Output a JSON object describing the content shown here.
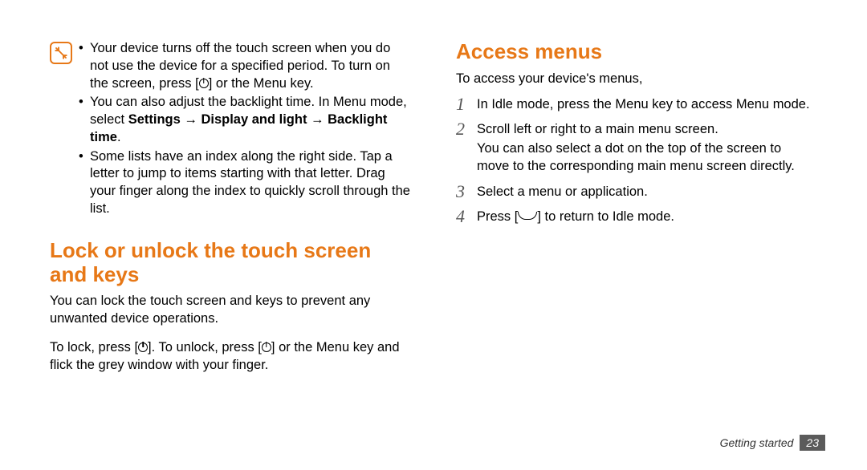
{
  "left": {
    "note_items": [
      {
        "pre": "Your device turns off the touch screen when you do not use the device for a specified period. To turn on the screen, press [",
        "icon": "power",
        "post": "] or the Menu key."
      },
      {
        "pre": "You can also adjust the backlight time. In Menu mode, select ",
        "bold": "Settings → Display and light → Backlight time",
        "post": "."
      },
      {
        "pre": "Some lists have an index along the right side. Tap a letter to jump to items starting with that letter. Drag your finger along the index to quickly scroll through the list."
      }
    ],
    "heading": "Lock or unlock the touch screen and keys",
    "p1": "You can lock the touch screen and keys to prevent any unwanted device operations.",
    "p2_pre": "To lock, press [",
    "p2_mid": "]. To unlock, press [",
    "p2_post": "] or the Menu key and flick the grey window with your finger."
  },
  "right": {
    "heading": "Access menus",
    "intro": "To access your device's menus,",
    "steps": [
      {
        "num": "1",
        "text": "In Idle mode, press the Menu key to access Menu mode."
      },
      {
        "num": "2",
        "text": "Scroll left or right to a main menu screen.",
        "sub": "You can also select a dot on the top of the screen to move to the corresponding main menu screen directly."
      },
      {
        "num": "3",
        "text": "Select a menu or application."
      },
      {
        "num": "4",
        "pre": "Press [",
        "icon": "end",
        "post": "] to return to Idle mode."
      }
    ]
  },
  "footer": {
    "section": "Getting started",
    "page": "23"
  }
}
